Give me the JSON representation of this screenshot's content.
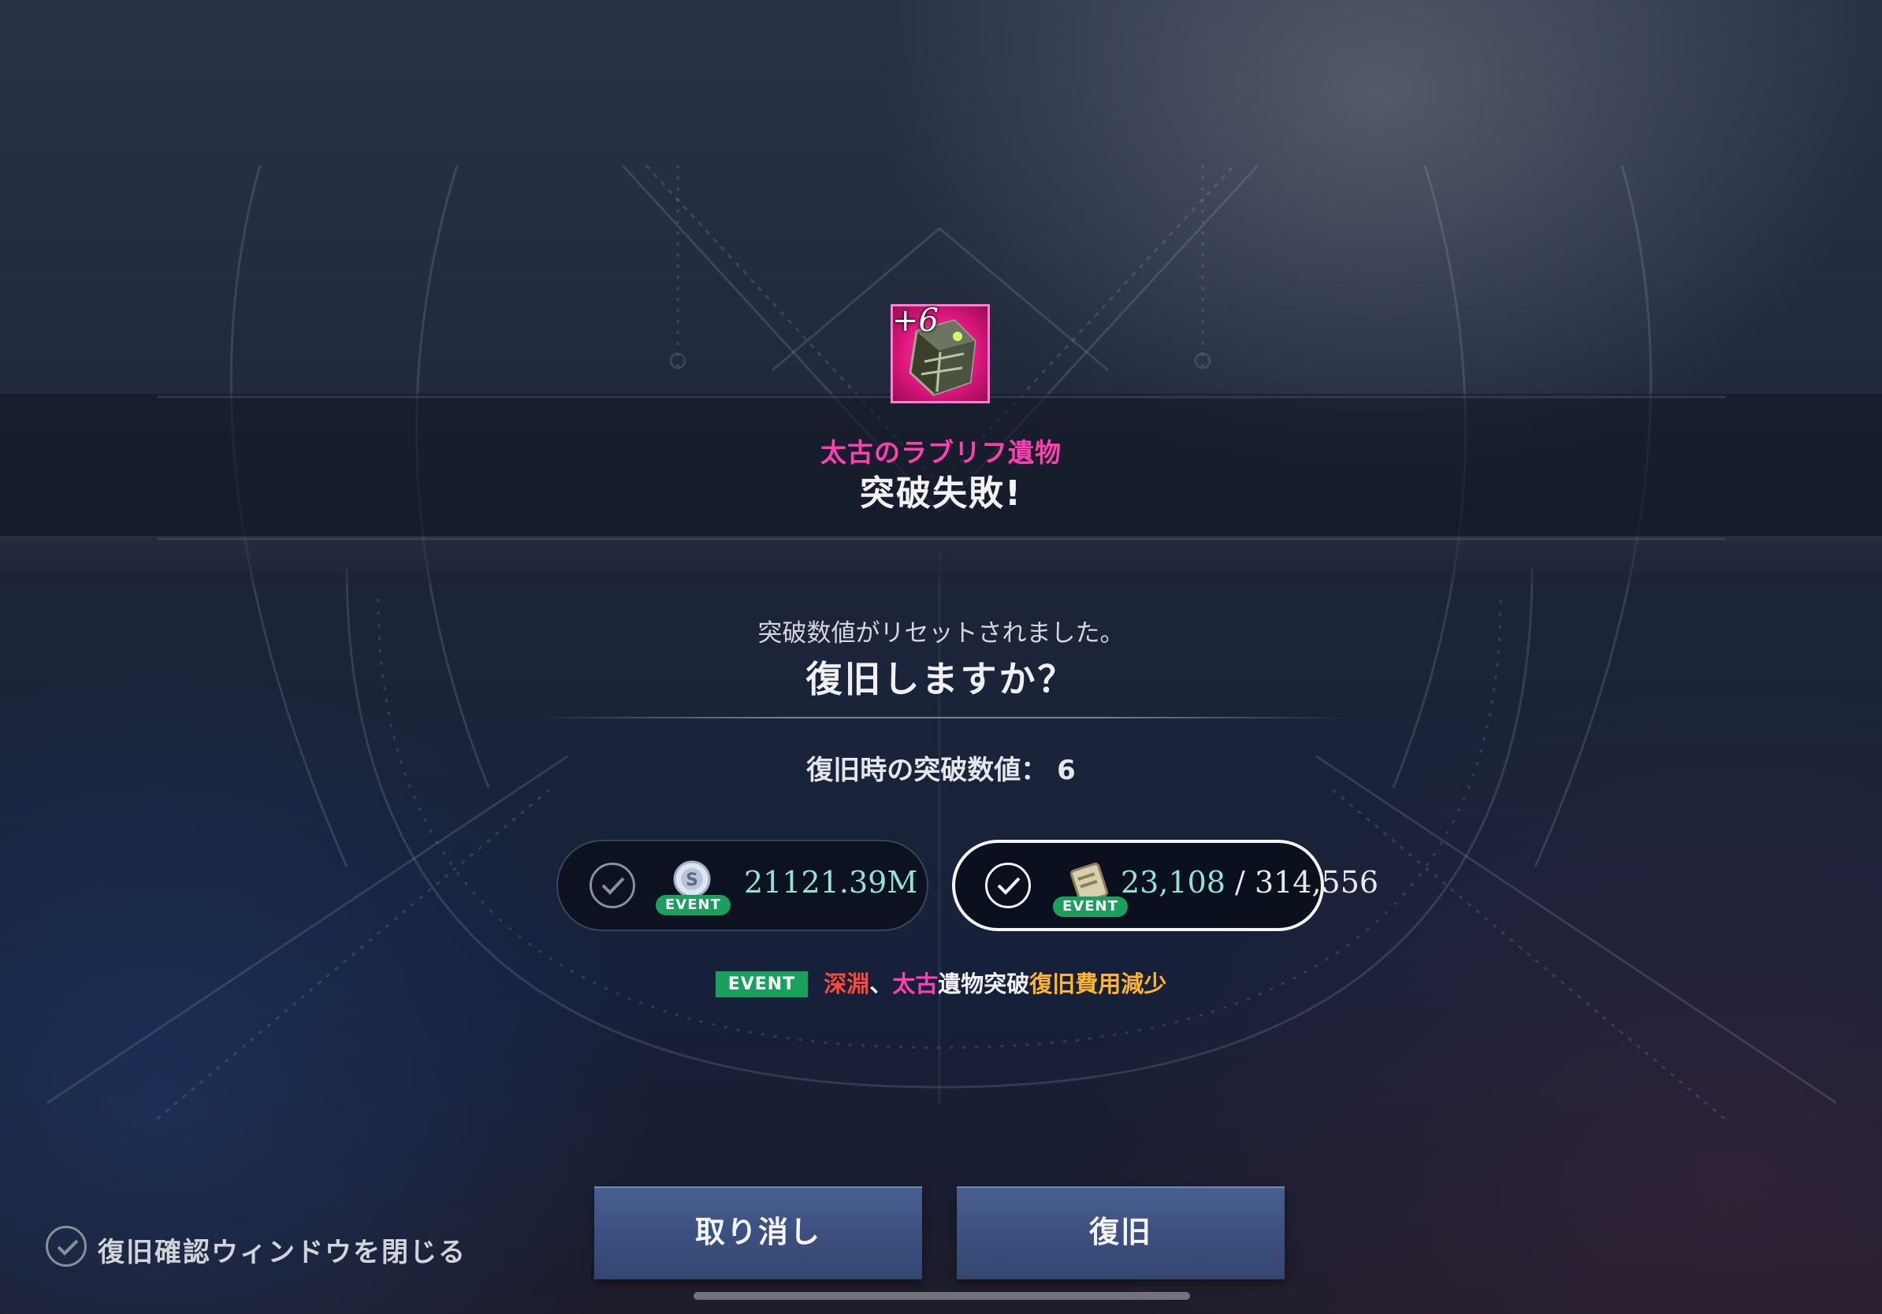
{
  "item": {
    "name": "太古のラブリフ遺物",
    "enhance_level": "+6",
    "grade_color": "#e0177f"
  },
  "result": {
    "title": "突破失敗!"
  },
  "dialog": {
    "description": "突破数値がリセットされました。",
    "question": "復旧しますか？",
    "restore_value_line": "復旧時の突破数値： 6"
  },
  "cost_options": [
    {
      "icon": "silver-coin-icon",
      "badge": "EVENT",
      "amount": "21121.39M",
      "selected": false
    },
    {
      "icon": "scroll-icon",
      "badge": "EVENT",
      "amount_owned": "23,108",
      "separator": " / ",
      "amount_required": "314,556",
      "selected": true
    }
  ],
  "event_note": {
    "tag": "EVENT",
    "part1": "深淵",
    "part2": "、",
    "part3": "太古",
    "part4": "遺物突破",
    "part5": "復旧費用減少"
  },
  "buttons": {
    "cancel": "取り消し",
    "restore": "復旧"
  },
  "close_window": {
    "label": "復旧確認ウィンドウを閉じる",
    "checked": false
  },
  "colors": {
    "item_name": "#ff3fb1",
    "amount": "#8fe3da",
    "event_green": "#18a15c",
    "button": "#3c5080"
  }
}
